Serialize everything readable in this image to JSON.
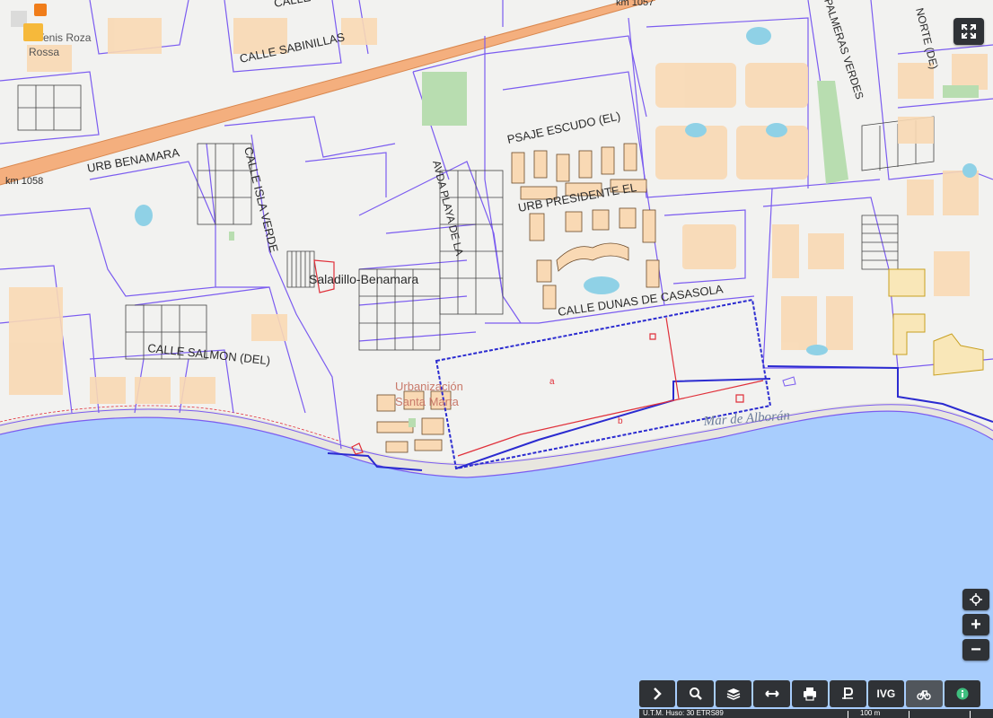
{
  "map": {
    "sea_label": "Mar de Alborán",
    "street_labels": [
      "CALLE SABINILLAS",
      "URB BENAMARA",
      "km 1058",
      "CALLE ISLA VERDE",
      "AVDA PLAYA DE LA",
      "PSAJE ESCUDO (EL)",
      "URB PRESIDENTE EL",
      "CALLE DUNAS DE CASASOLA",
      "CALLE SALMON (DEL)",
      "CALLE",
      "km 1057",
      "PALMERAS VERDES",
      "NORTE (DE)"
    ],
    "place_labels": [
      "Saladillo-Benamara",
      "Urbanización",
      "Santa Marta",
      "Tenis Roza",
      "Rossa"
    ],
    "parcel_labels": [
      "a",
      "b"
    ],
    "colors": {
      "sea": "#a8cdfd",
      "land": "#f2f2f0",
      "buildings": "#f9d9b4",
      "parcel_lines": "#7b5cf0",
      "highway": "#f5a36a",
      "selection": "#2b2bd0",
      "red_line": "#e0303a",
      "pools": "#8fd1e6",
      "green": "#b8ddb0"
    }
  },
  "controls": {
    "fullscreen_icon": "expand-icon",
    "locate_icon": "crosshair-icon",
    "zoom_in": "+",
    "zoom_out": "−"
  },
  "toolbar": {
    "items": [
      {
        "icon": "chevron-right-icon",
        "label": ""
      },
      {
        "icon": "search-icon",
        "label": ""
      },
      {
        "icon": "layers-icon",
        "label": ""
      },
      {
        "icon": "measure-icon",
        "label": ""
      },
      {
        "icon": "print-icon",
        "label": ""
      },
      {
        "icon": "parking-icon",
        "label": ""
      },
      {
        "icon": "",
        "label": "IVG"
      },
      {
        "icon": "bike-icon",
        "label": ""
      },
      {
        "icon": "info-icon",
        "label": ""
      }
    ]
  },
  "scalebar": {
    "projection": "U.T.M. Huso: 30 ETRS89",
    "distance": "100 m"
  }
}
